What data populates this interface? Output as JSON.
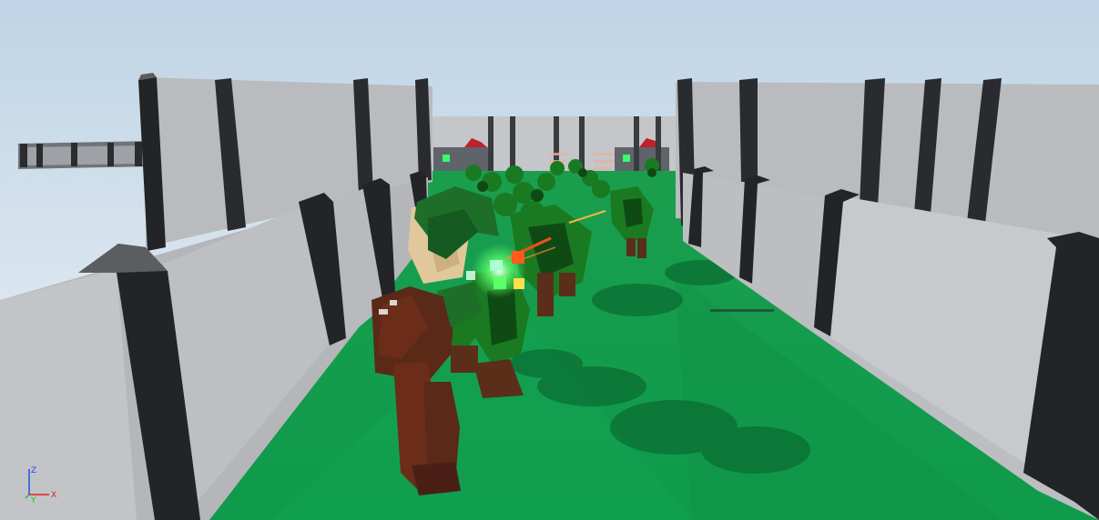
{
  "viewport": {
    "title": "",
    "sky_top": "#bfd4e6",
    "sky_bottom": "#eef3f6"
  },
  "scene": {
    "floor_color": "#13a456",
    "wall_color": "#b7b9bd",
    "wall_light": "#c8cacd",
    "pillar_color": "#2a2b2e",
    "pillar_cap": "#5b5d60",
    "crate_color": "#595f66",
    "beacon_color": "#39ff6a",
    "player": {
      "name": "player-character",
      "hood": "#1e6e2a",
      "skin": "#e0c89a",
      "tunic": "#6b2d1a",
      "cape": "#5a2918"
    },
    "enemies": {
      "name": "enemy-horde",
      "body": "#1a7a22",
      "dark": "#0f4a14",
      "legs": "#5b2e1a"
    },
    "projectile_colors": [
      "#ff4a1a",
      "#ffb53a"
    ],
    "glow_colors": [
      "#5cff6c",
      "#ff5a1a",
      "#aaffcc"
    ]
  },
  "axis_gizmo": {
    "labels": {
      "x": "X",
      "y": "Y",
      "z": "Z"
    },
    "colors": {
      "x": "#e02020",
      "y": "#20c020",
      "z": "#2050e0"
    }
  }
}
